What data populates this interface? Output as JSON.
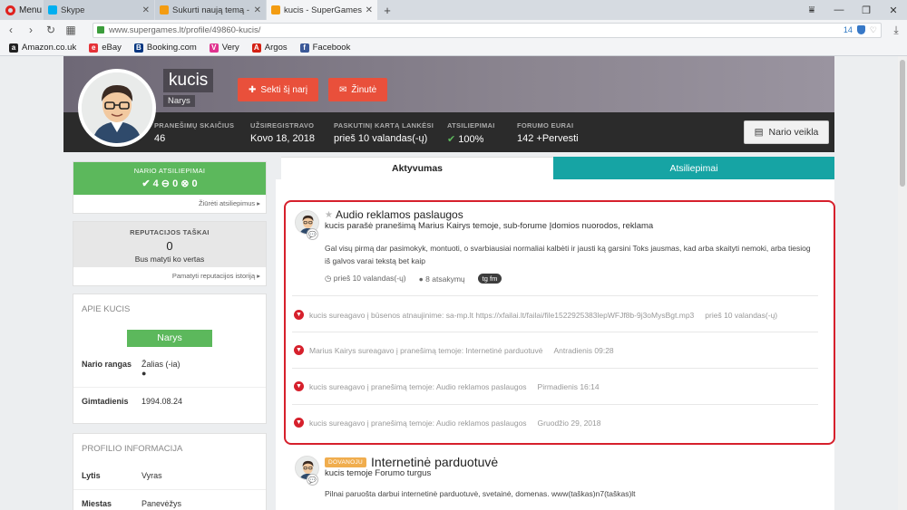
{
  "browser": {
    "menu_label": "Menu",
    "tabs": [
      {
        "label": "Skype",
        "color": "#00aff0",
        "active": false
      },
      {
        "label": "Sukurti naują temą - SuperG...",
        "color": "#f39c12",
        "active": false
      },
      {
        "label": "kucis - SuperGames.lt - Lie...",
        "color": "#f39c12",
        "active": true
      }
    ],
    "new_tab": "+",
    "url": "www.supergames.lt/profile/49860-kucis/",
    "badge_count": "14",
    "bookmarks": [
      {
        "label": "Amazon.co.uk",
        "icon": "a",
        "color": "#222"
      },
      {
        "label": "eBay",
        "icon": "e",
        "color": "#e53238"
      },
      {
        "label": "Booking.com",
        "icon": "B",
        "color": "#003580"
      },
      {
        "label": "Very",
        "icon": "V",
        "color": "#e0338f"
      },
      {
        "label": "Argos",
        "icon": "A",
        "color": "#d42114"
      },
      {
        "label": "Facebook",
        "icon": "f",
        "color": "#3b5998"
      }
    ]
  },
  "profile": {
    "username": "kucis",
    "rank": "Narys",
    "follow_label": "Sekti šį narį",
    "message_label": "Žinutė",
    "activity_label": "Nario veikla",
    "stats": [
      {
        "label": "PRANEŠIMŲ SKAIČIUS",
        "value": "46"
      },
      {
        "label": "UŽSIREGISTRAVO",
        "value": "Kovo 18, 2018"
      },
      {
        "label": "PASKUTINĮ KARTĄ LANKĖSI",
        "value": "prieš 10 valandas(-ų)"
      },
      {
        "label": "ATSILIEPIMAI",
        "value": "100%"
      },
      {
        "label": "FORUMO EURAI",
        "value": "142 +Pervesti"
      }
    ]
  },
  "sidebar": {
    "feedback": {
      "heading": "NARIO ATSILIEPIMAI",
      "positive": "4",
      "neutral": "0",
      "negative": "0",
      "link": "Žiūrėti atsiliepimus"
    },
    "reputation": {
      "heading": "REPUTACIJOS TAŠKAI",
      "value": "0",
      "subtitle": "Bus matyti ko vertas",
      "link": "Pamatyti reputacijos istoriją"
    },
    "about": {
      "heading": "APIE KUCIS",
      "rank_badge": "Narys",
      "rows": [
        {
          "key": "Nario rangas",
          "value": "Žalias (-ia)"
        },
        {
          "key": "Gimtadienis",
          "value": "1994.08.24"
        }
      ]
    },
    "info": {
      "heading": "PROFILIO INFORMACIJA",
      "rows": [
        {
          "key": "Lytis",
          "value": "Vyras"
        },
        {
          "key": "Miestas",
          "value": "Panevėžys"
        }
      ]
    }
  },
  "tabs": {
    "activity": "Aktyvumas",
    "feedback": "Atsiliepimai"
  },
  "feed": {
    "post1": {
      "title": "Audio reklamos paslaugos",
      "subtitle": "kucis parašė pranešimą Marius Kairys temoje, sub-forume Įdomios nuorodos, reklama",
      "body": "Gal visų pirmą dar pasimokyk, montuoti, o svarbiausiai normaliai kalbėti ir jausti ką garsini Toks jausmas, kad arba skaityti nemoki, arba tiesiog iš galvos varai tekstą bet kaip",
      "time": "prieš 10 valandas(-ų)",
      "replies": "8 atsakymų",
      "tag": "tg fm"
    },
    "activities": [
      {
        "text": "kucis sureagavo į būsenos atnaujinime: sa-mp.lt https://xfailai.lt/failai/file1522925383lepWFJf8b-9j3oMysBgt.mp3",
        "time": "prieš 10 valandas(-ų)"
      },
      {
        "text": "Marius Kairys sureagavo į pranešimą temoje: Internetinė parduotuvė",
        "time": "Antradienis 09:28"
      },
      {
        "text": "kucis sureagavo į pranešimą temoje: Audio reklamos paslaugos",
        "time": "Pirmadienis 16:14"
      },
      {
        "text": "kucis sureagavo į pranešimą temoje: Audio reklamos paslaugos",
        "time": "Gruodžio 29, 2018"
      }
    ],
    "post2": {
      "badge": "DOVANOJU",
      "title": "Internetinė parduotuvė",
      "subtitle": "kucis temoje Forumo turgus",
      "body": "Pilnai paruošta darbui internetinė parduotuvė, svetainė, domenas. www(taškas)n7(taškas)lt"
    }
  },
  "colors": {
    "accent_red": "#e9503b",
    "teal": "#16a4a4",
    "green": "#5cb85c",
    "highlight": "#d6202c"
  }
}
